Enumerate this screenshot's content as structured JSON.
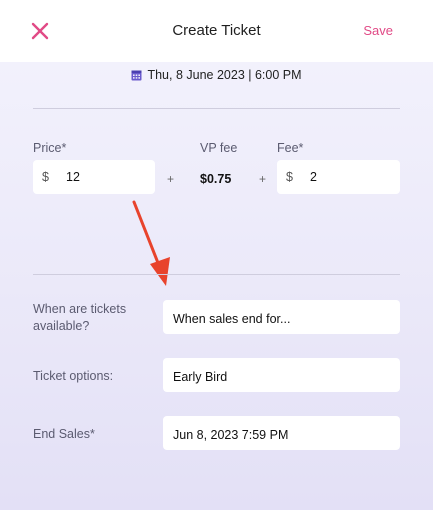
{
  "header": {
    "title": "Create Ticket",
    "save_label": "Save",
    "close_color": "#e14a86"
  },
  "date": {
    "text": "Thu, 8 June 2023 | 6:00 PM",
    "icon": "calendar-icon"
  },
  "pricing": {
    "price_label": "Price*",
    "price_currency": "$",
    "price_value": "12",
    "plus_1": "+",
    "vp_fee_label": "VP fee",
    "vp_fee_value": "$0.75",
    "plus_2": "+",
    "fee_label": "Fee*",
    "fee_currency": "$",
    "fee_value": "2"
  },
  "fields": {
    "availability_label_line1": "When are tickets",
    "availability_label_line2": "available?",
    "availability_value": "When sales end for...",
    "ticket_options_label": "Ticket options:",
    "ticket_options_value": "Early Bird",
    "end_sales_label": "End Sales*",
    "end_sales_value": "Jun 8, 2023 7:59 PM"
  },
  "colors": {
    "accent": "#e14a86",
    "calendar": "#6a5acd",
    "annotation_arrow": "#e8432c"
  }
}
